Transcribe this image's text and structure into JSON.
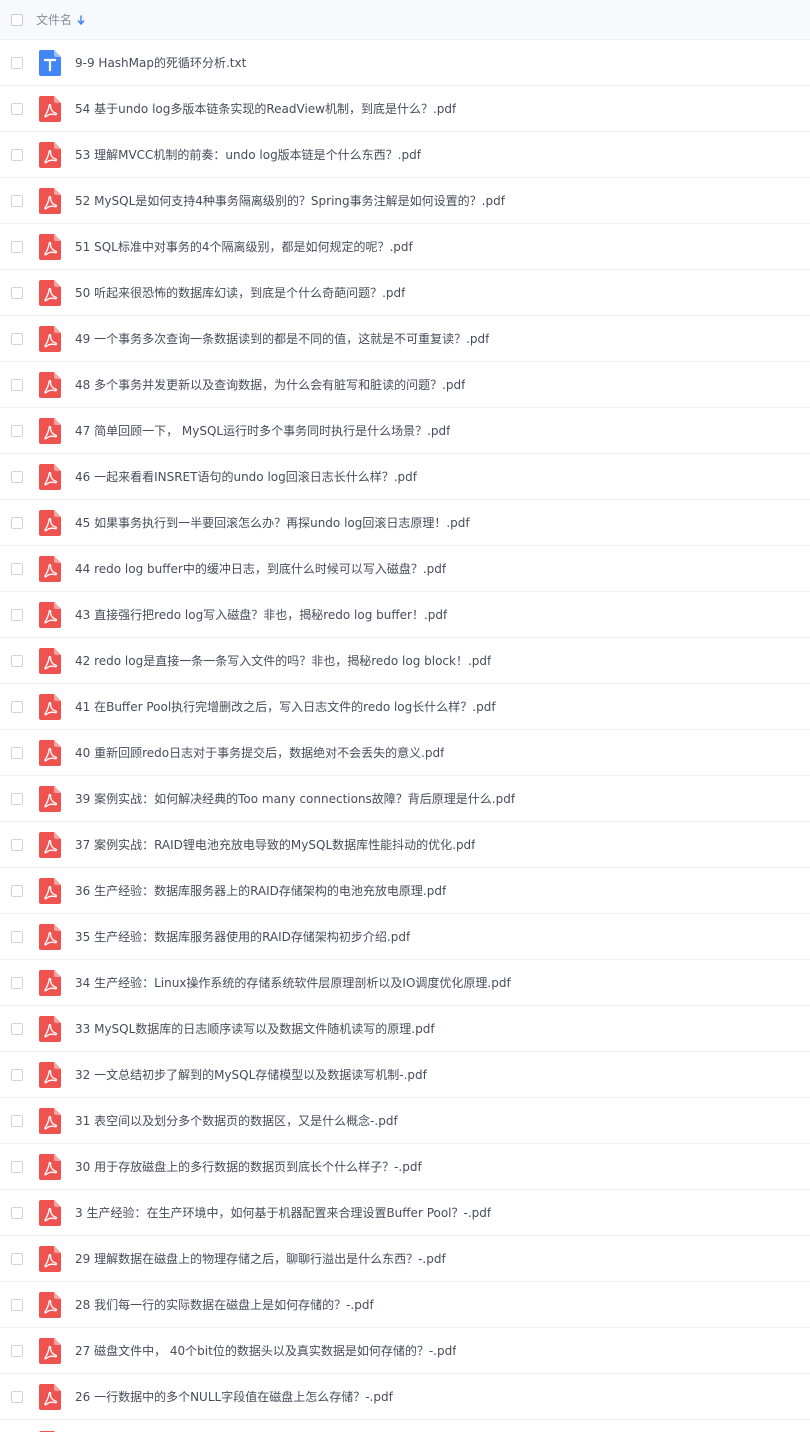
{
  "header": {
    "column_label": "文件名",
    "sort_icon": "arrow-down-icon"
  },
  "colors": {
    "pdf_icon": "#ef5350",
    "txt_icon": "#4285f4",
    "sort_accent": "#3b82f6",
    "header_bg": "#f7f9fc"
  },
  "files": [
    {
      "name": "9-9 HashMap的死循环分析.txt",
      "type": "txt"
    },
    {
      "name": "54 基于undo log多版本链条实现的ReadView机制，到底是什么？.pdf",
      "type": "pdf"
    },
    {
      "name": "53 理解MVCC机制的前奏：undo log版本链是个什么东西？.pdf",
      "type": "pdf"
    },
    {
      "name": "52 MySQL是如何支持4种事务隔离级别的？Spring事务注解是如何设置的？.pdf",
      "type": "pdf"
    },
    {
      "name": "51 SQL标准中对事务的4个隔离级别，都是如何规定的呢？.pdf",
      "type": "pdf"
    },
    {
      "name": "50 听起来很恐怖的数据库幻读，到底是个什么奇葩问题？.pdf",
      "type": "pdf"
    },
    {
      "name": "49 一个事务多次查询一条数据读到的都是不同的值，这就是不可重复读？.pdf",
      "type": "pdf"
    },
    {
      "name": "48 多个事务并发更新以及查询数据，为什么会有脏写和脏读的问题？.pdf",
      "type": "pdf"
    },
    {
      "name": "47 简单回顾一下， MySQL运行时多个事务同时执行是什么场景？.pdf",
      "type": "pdf"
    },
    {
      "name": "46 一起来看看INSRET语句的undo log回滚日志长什么样？.pdf",
      "type": "pdf"
    },
    {
      "name": "45 如果事务执行到一半要回滚怎么办？再探undo log回滚日志原理！.pdf",
      "type": "pdf"
    },
    {
      "name": "44 redo log buffer中的缓冲日志，到底什么时候可以写入磁盘？.pdf",
      "type": "pdf"
    },
    {
      "name": "43 直接强行把redo log写入磁盘？非也，揭秘redo log buffer！.pdf",
      "type": "pdf"
    },
    {
      "name": "42 redo log是直接一条一条写入文件的吗？非也，揭秘redo log block！.pdf",
      "type": "pdf"
    },
    {
      "name": "41 在Buffer Pool执行完增删改之后，写入日志文件的redo log长什么样？.pdf",
      "type": "pdf"
    },
    {
      "name": "40 重新回顾redo日志对于事务提交后，数据绝对不会丢失的意义.pdf",
      "type": "pdf"
    },
    {
      "name": "39 案例实战：如何解决经典的Too many connections故障？背后原理是什么.pdf",
      "type": "pdf"
    },
    {
      "name": "37 案例实战：RAID锂电池充放电导致的MySQL数据库性能抖动的优化.pdf",
      "type": "pdf"
    },
    {
      "name": "36 生产经验：数据库服务器上的RAID存储架构的电池充放电原理.pdf",
      "type": "pdf"
    },
    {
      "name": "35 生产经验：数据库服务器使用的RAID存储架构初步介绍.pdf",
      "type": "pdf"
    },
    {
      "name": "34 生产经验：Linux操作系统的存储系统软件层原理剖析以及IO调度优化原理.pdf",
      "type": "pdf"
    },
    {
      "name": "33 MySQL数据库的日志顺序读写以及数据文件随机读写的原理.pdf",
      "type": "pdf"
    },
    {
      "name": "32 一文总结初步了解到的MySQL存储模型以及数据读写机制-.pdf",
      "type": "pdf"
    },
    {
      "name": "31 表空间以及划分多个数据页的数据区，又是什么概念-.pdf",
      "type": "pdf"
    },
    {
      "name": "30 用于存放磁盘上的多行数据的数据页到底长个什么样子？-.pdf",
      "type": "pdf"
    },
    {
      "name": "3 生产经验：在生产环境中，如何基于机器配置来合理设置Buffer Pool？-.pdf",
      "type": "pdf"
    },
    {
      "name": "29 理解数据在磁盘上的物理存储之后，聊聊行溢出是什么东西？-.pdf",
      "type": "pdf"
    },
    {
      "name": "28 我们每一行的实际数据在磁盘上是如何存储的？-.pdf",
      "type": "pdf"
    },
    {
      "name": "27 磁盘文件中， 40个bit位的数据头以及真实数据是如何存储的？-.pdf",
      "type": "pdf"
    },
    {
      "name": "26 一行数据中的多个NULL字段值在磁盘上怎么存储？-.pdf",
      "type": "pdf"
    }
  ]
}
